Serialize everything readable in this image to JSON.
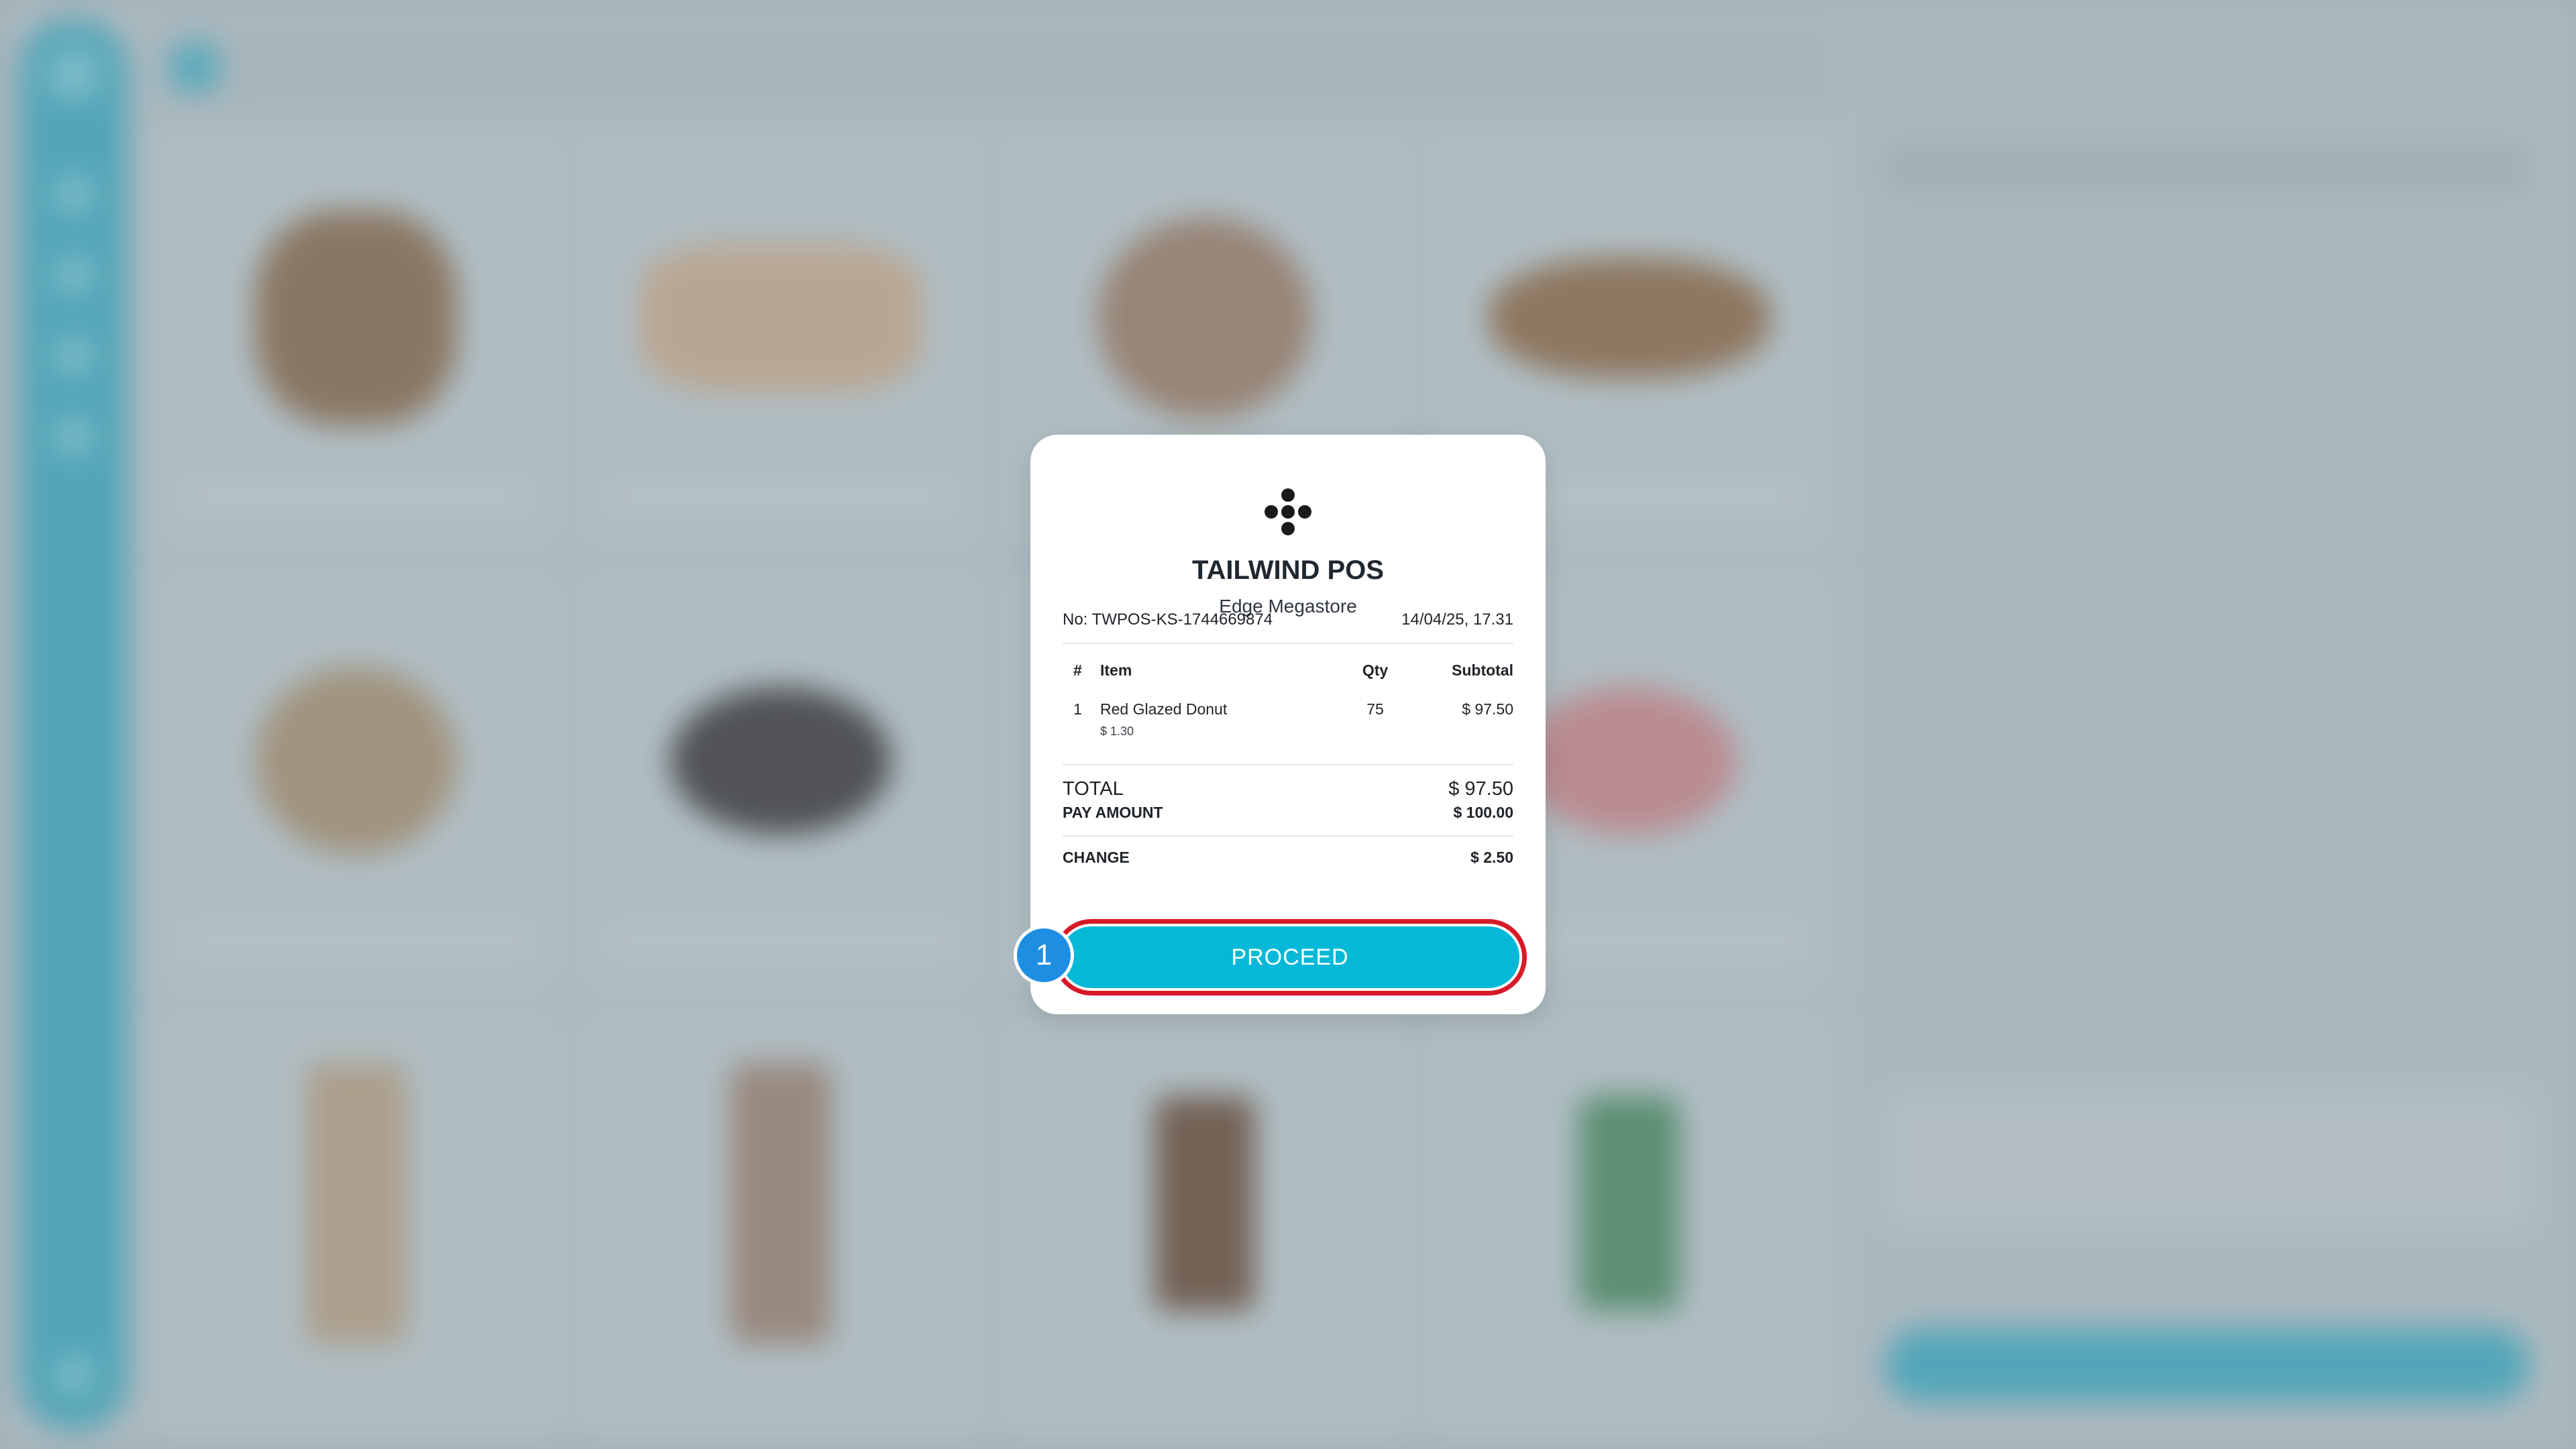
{
  "receipt": {
    "store_name": "TAILWIND POS",
    "branch": "Edge Megastore",
    "number": "No: TWPOS-KS-1744669874",
    "datetime": "14/04/25, 17.31",
    "columns": {
      "num": "#",
      "item": "Item",
      "qty": "Qty",
      "subtotal": "Subtotal"
    },
    "items": [
      {
        "num": "1",
        "name": "Red Glazed Donut",
        "unit_price": "$ 1.30",
        "qty": "75",
        "subtotal": "$ 97.50"
      }
    ],
    "total_label": "TOTAL",
    "total_value": "$ 97.50",
    "pay_label": "PAY AMOUNT",
    "pay_value": "$ 100.00",
    "change_label": "CHANGE",
    "change_value": "$ 2.50",
    "proceed_label": "PROCEED"
  },
  "step_badge": "1",
  "colors": {
    "accent": "#06b8d8",
    "highlight_ring": "#d61a28",
    "badge": "#1e8ee3",
    "sidebar": "#3fa7bd"
  }
}
